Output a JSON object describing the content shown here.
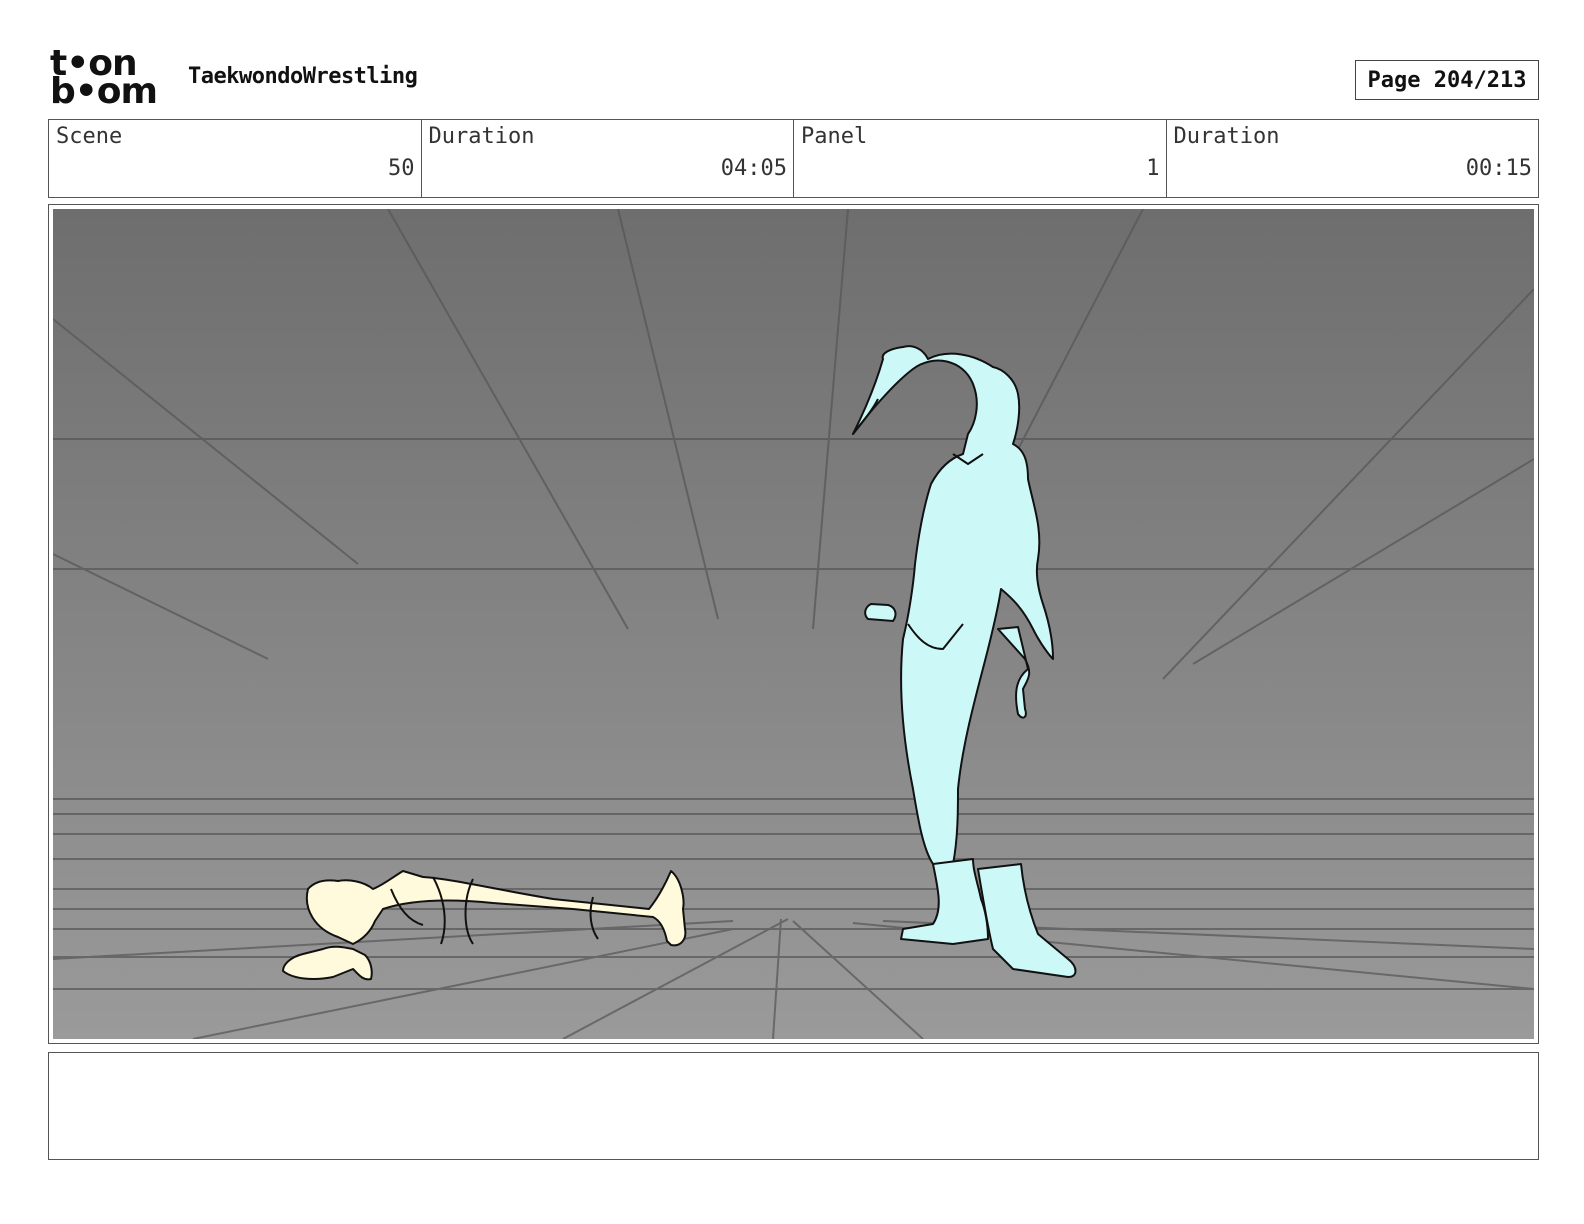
{
  "header": {
    "logo_line1": "t•on",
    "logo_line2": "b•om",
    "project_title": "TaekwondoWrestling",
    "page_label": "Page 204/213"
  },
  "info": {
    "scene_label": "Scene",
    "scene_value": "50",
    "scene_duration_label": "Duration",
    "scene_duration_value": "04:05",
    "panel_label": "Panel",
    "panel_value": "1",
    "panel_duration_label": "Duration",
    "panel_duration_value": "00:15"
  },
  "notes": {
    "text": ""
  },
  "colors": {
    "bg_top": "#6e6e6e",
    "bg_bottom": "#9a9a9a",
    "standing_figure": "#ccf9f8",
    "lying_figure": "#fffadc"
  }
}
